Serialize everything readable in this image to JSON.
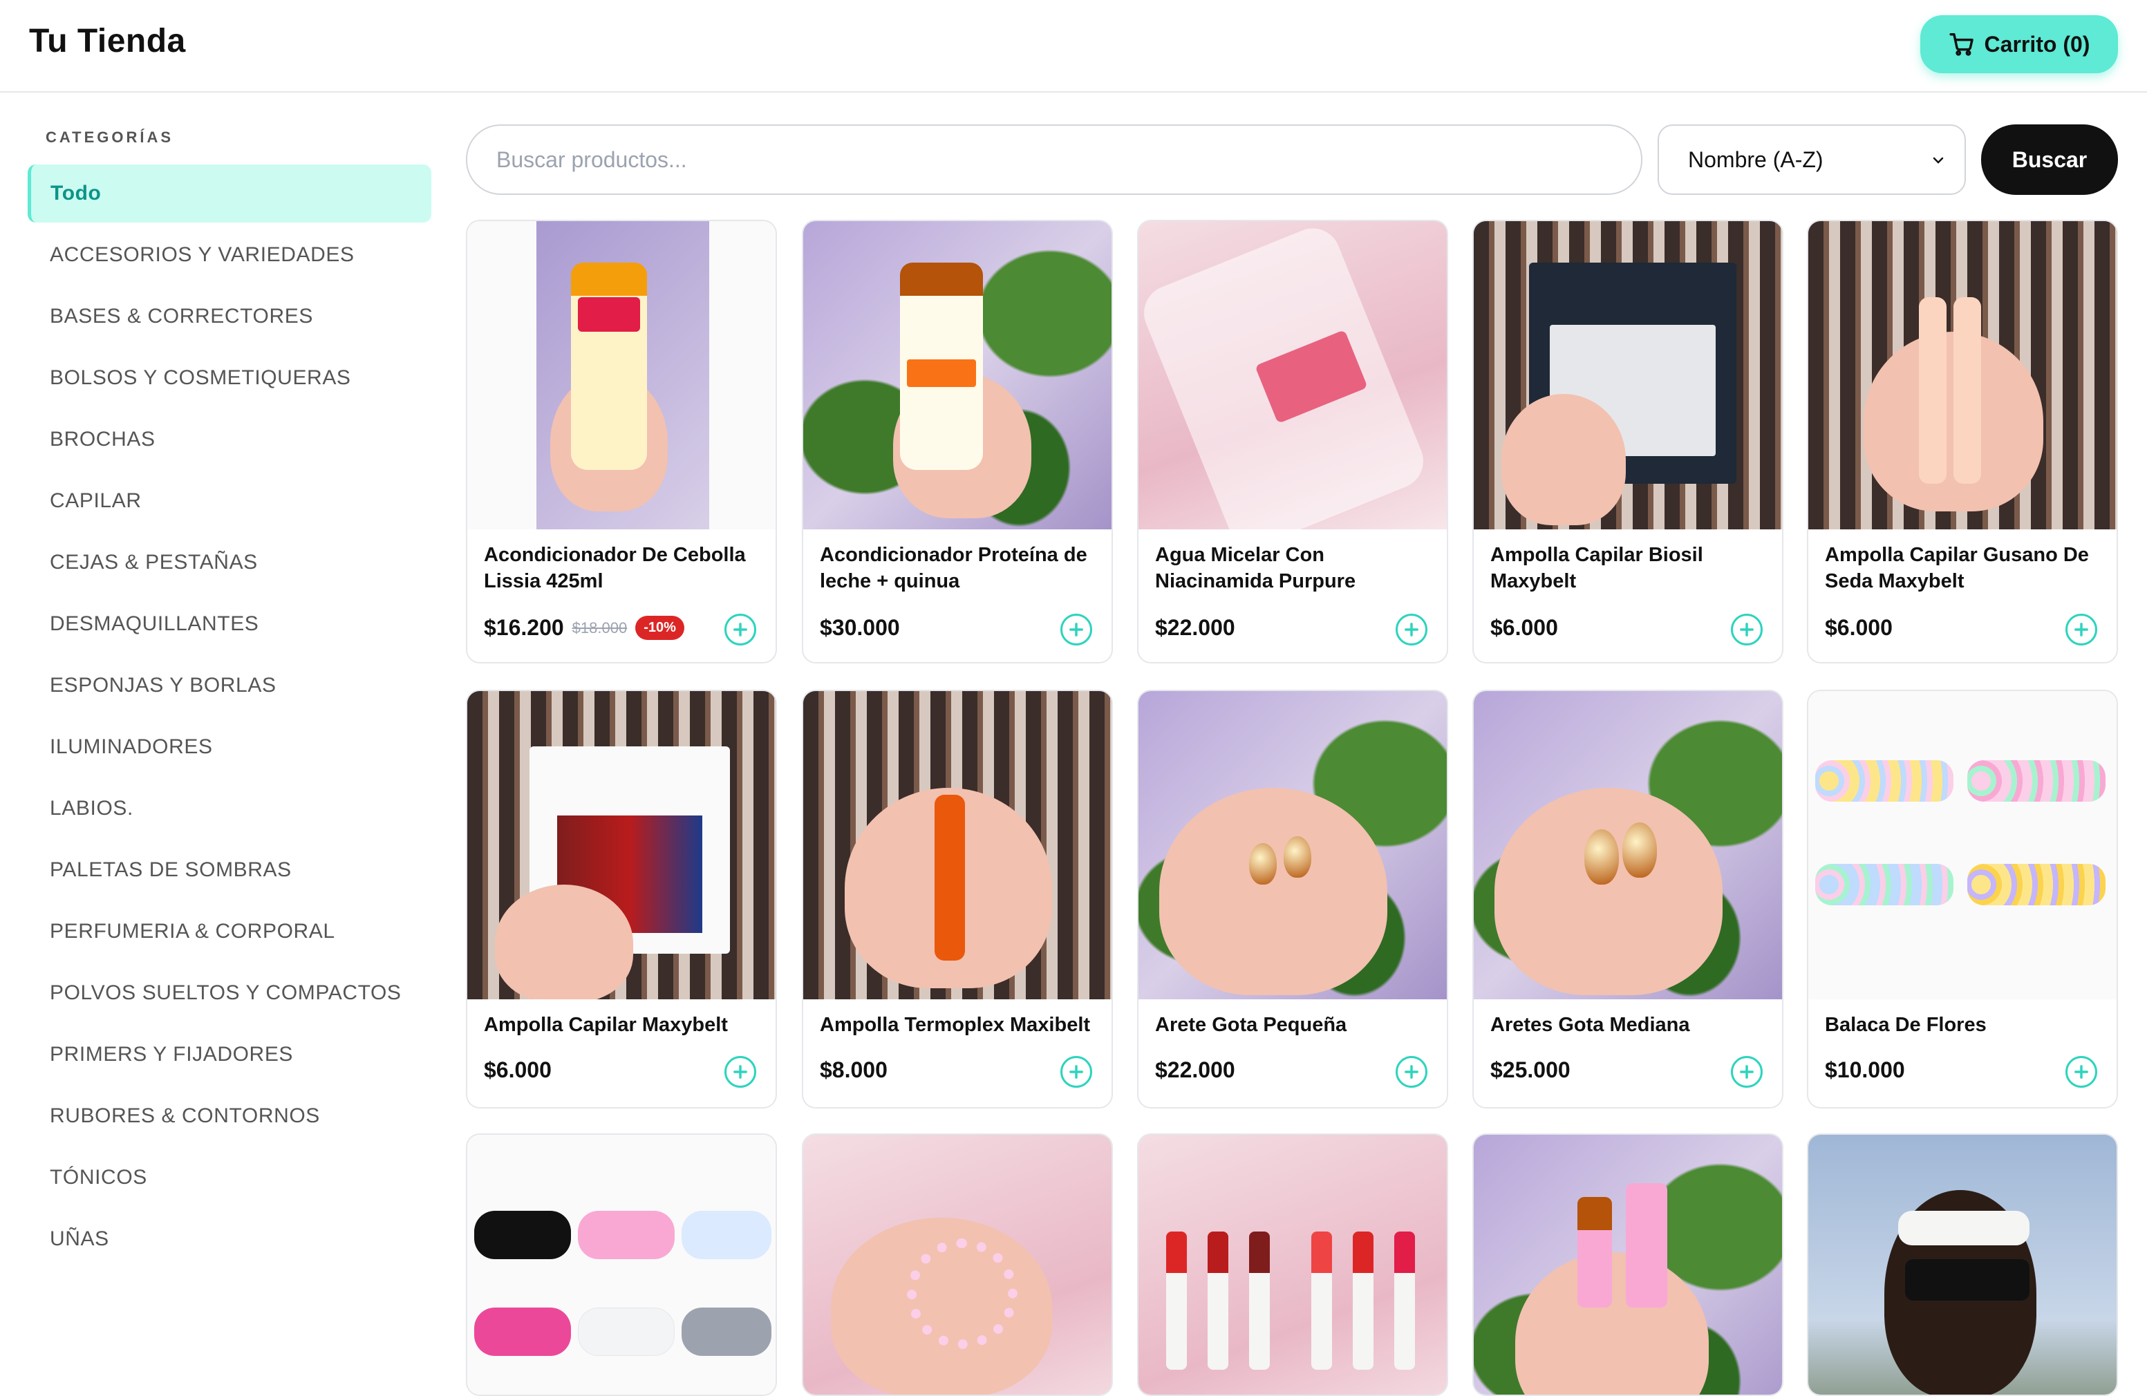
{
  "header": {
    "logo": "Tu Tienda",
    "cart_label": "Carrito (0)"
  },
  "sidebar": {
    "title": "CATEGORÍAS",
    "items": [
      {
        "label": "Todo",
        "active": true
      },
      {
        "label": "ACCESORIOS Y VARIEDADES"
      },
      {
        "label": "BASES & CORRECTORES"
      },
      {
        "label": "BOLSOS Y COSMETIQUERAS"
      },
      {
        "label": "BROCHAS"
      },
      {
        "label": "CAPILAR"
      },
      {
        "label": "CEJAS & PESTAÑAS"
      },
      {
        "label": "DESMAQUILLANTES"
      },
      {
        "label": "ESPONJAS Y BORLAS"
      },
      {
        "label": "ILUMINADORES"
      },
      {
        "label": "LABIOS."
      },
      {
        "label": "PALETAS DE SOMBRAS"
      },
      {
        "label": "PERFUMERIA & CORPORAL"
      },
      {
        "label": "POLVOS SUELTOS Y COMPACTOS"
      },
      {
        "label": "PRIMERS Y FIJADORES"
      },
      {
        "label": "RUBORES & CONTORNOS"
      },
      {
        "label": "TÓNICOS"
      },
      {
        "label": "UÑAS"
      }
    ]
  },
  "search": {
    "placeholder": "Buscar productos...",
    "sort_value": "Nombre (A-Z)",
    "button_label": "Buscar"
  },
  "products": [
    {
      "name": "Acondicionador De Cebolla Lissia 425ml",
      "price": "$16.200",
      "old_price": "$18.000",
      "discount": "-10%"
    },
    {
      "name": "Acondicionador Proteína de leche + quinua",
      "price": "$30.000"
    },
    {
      "name": "Agua Micelar Con Niacinamida Purpure",
      "price": "$22.000"
    },
    {
      "name": "Ampolla Capilar Biosil Maxybelt",
      "price": "$6.000"
    },
    {
      "name": "Ampolla Capilar Gusano De Seda Maxybelt",
      "price": "$6.000"
    },
    {
      "name": "Ampolla Capilar Maxybelt",
      "price": "$6.000"
    },
    {
      "name": "Ampolla Termoplex Maxibelt",
      "price": "$8.000"
    },
    {
      "name": "Arete Gota Pequeña",
      "price": "$22.000"
    },
    {
      "name": "Aretes Gota Mediana",
      "price": "$25.000"
    },
    {
      "name": "Balaca De Flores",
      "price": "$10.000"
    }
  ],
  "colors": {
    "accent": "#5eead4",
    "active_bg": "#ccfbf1",
    "discount": "#dc2626"
  }
}
